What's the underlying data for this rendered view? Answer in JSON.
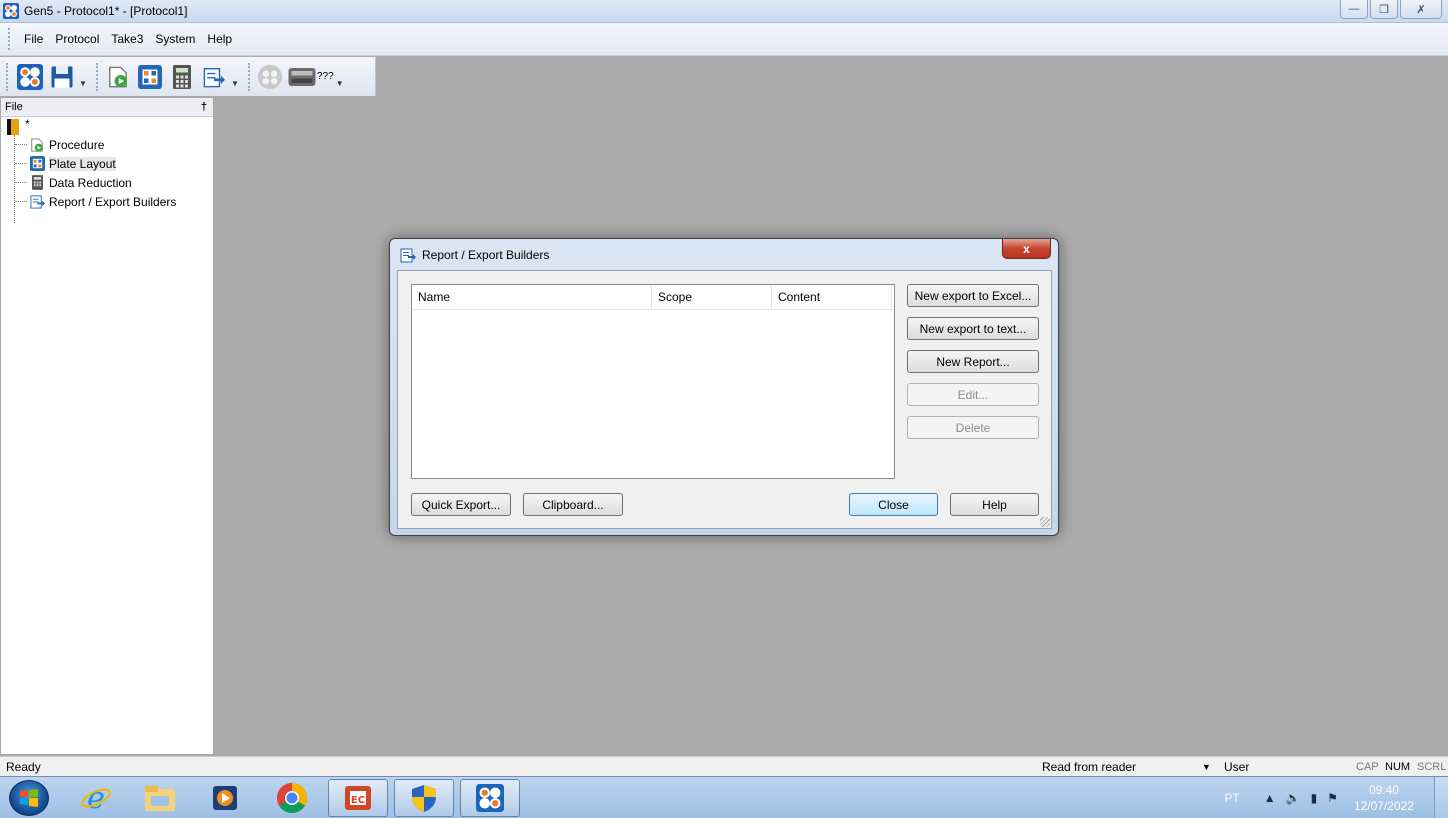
{
  "window": {
    "title": "Gen5 - Protocol1* - [Protocol1]"
  },
  "menu": {
    "items": [
      "File",
      "Protocol",
      "Take3",
      "System",
      "Help"
    ]
  },
  "toolbar": {
    "reader_label": "???"
  },
  "left_panel": {
    "header": "File",
    "pin_glyph": "†",
    "root_label": "*",
    "items": [
      {
        "label": "Procedure",
        "icon": "procedure-icon"
      },
      {
        "label": "Plate Layout",
        "icon": "plate-layout-icon"
      },
      {
        "label": "Data Reduction",
        "icon": "data-reduction-icon"
      },
      {
        "label": "Report / Export Builders",
        "icon": "report-export-icon"
      }
    ],
    "selected": "Plate Layout"
  },
  "dialog": {
    "title": "Report / Export Builders",
    "close_glyph": "x",
    "columns": [
      "Name",
      "Scope",
      "Content"
    ],
    "rows": [],
    "buttons": {
      "new_excel": "New export to Excel...",
      "new_text": "New export to text...",
      "new_report": "New Report...",
      "edit": "Edit...",
      "delete": "Delete",
      "quick_export": "Quick Export...",
      "clipboard": "Clipboard...",
      "close": "Close",
      "help": "Help"
    }
  },
  "statusbar": {
    "status": "Ready",
    "reader": "Read from reader",
    "user": "User",
    "indicators": {
      "cap": "CAP",
      "num": "NUM",
      "scrl": "SCRL"
    }
  },
  "taskbar": {
    "language": "PT",
    "time": "09:40",
    "date": "12/07/2022",
    "apps": [
      "internet-explorer-icon",
      "file-explorer-icon",
      "media-player-icon",
      "chrome-icon",
      "presentation-app-icon",
      "security-shield-icon",
      "gen5-app-icon"
    ]
  },
  "colors": {
    "workspace": "#ababab",
    "dialog_frame": "#c6d6ea",
    "close_red": "#c5452f",
    "taskbar": "#9dbfe4"
  }
}
